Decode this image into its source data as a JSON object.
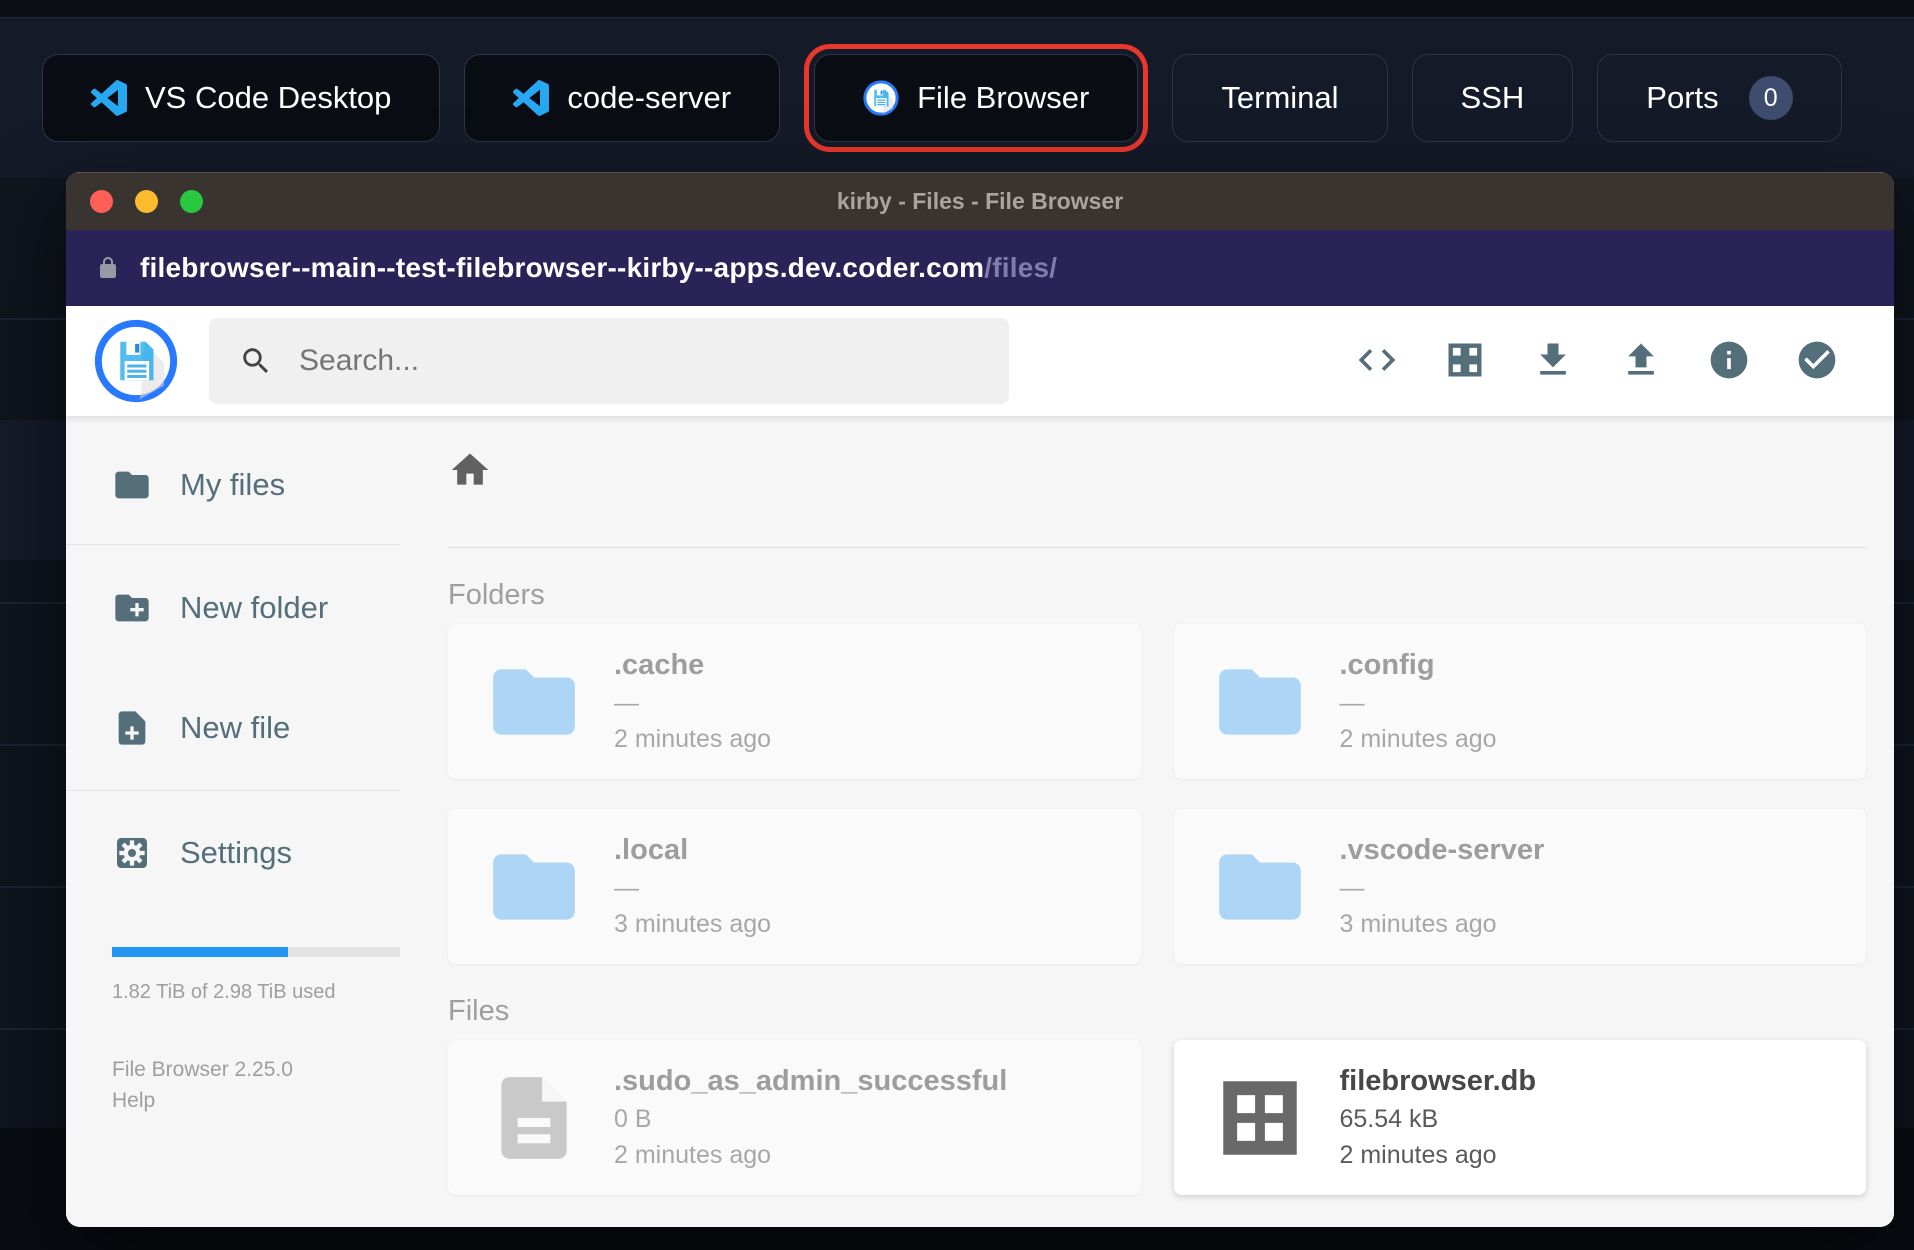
{
  "topbar": {
    "buttons": [
      {
        "label": "VS Code Desktop",
        "icon": "vscode",
        "style": "dark",
        "highlighted": false
      },
      {
        "label": "code-server",
        "icon": "vscode",
        "style": "dark",
        "highlighted": false
      },
      {
        "label": "File Browser",
        "icon": "filebrowser",
        "style": "dark",
        "highlighted": true
      },
      {
        "label": "Terminal",
        "style": "outline",
        "highlighted": false
      },
      {
        "label": "SSH",
        "style": "outline",
        "highlighted": false
      },
      {
        "label": "Ports",
        "style": "outline",
        "badge": "0",
        "highlighted": false
      }
    ]
  },
  "win": {
    "title": "kirby - Files - File Browser",
    "url": {
      "host": "filebrowser--main--test-filebrowser--kirby--apps.dev.coder.com",
      "path": "/files/"
    },
    "toolbar": {
      "search_placeholder": "Search...",
      "icons": [
        "code",
        "grid-view",
        "download",
        "upload",
        "info",
        "check-circle"
      ]
    },
    "sidebar": {
      "items": [
        {
          "label": "My files",
          "icon": "folder"
        },
        {
          "label": "New folder",
          "icon": "new-folder"
        },
        {
          "label": "New file",
          "icon": "new-file"
        },
        {
          "label": "Settings",
          "icon": "settings"
        }
      ],
      "storage": {
        "used_percent": 61,
        "label": "1.82 TiB of 2.98 TiB used"
      },
      "version": "File Browser 2.25.0",
      "help_label": "Help"
    },
    "content": {
      "sections": [
        {
          "title": "Folders",
          "items": [
            {
              "name": ".cache",
              "size": "—",
              "modified": "2 minutes ago",
              "icon": "folder",
              "faded": true
            },
            {
              "name": ".config",
              "size": "—",
              "modified": "2 minutes ago",
              "icon": "folder",
              "faded": true
            },
            {
              "name": ".local",
              "size": "—",
              "modified": "3 minutes ago",
              "icon": "folder",
              "faded": true
            },
            {
              "name": ".vscode-server",
              "size": "—",
              "modified": "3 minutes ago",
              "icon": "folder",
              "faded": true
            }
          ]
        },
        {
          "title": "Files",
          "items": [
            {
              "name": ".sudo_as_admin_successful",
              "size": "0 B",
              "modified": "2 minutes ago",
              "icon": "doc",
              "faded": true
            },
            {
              "name": "filebrowser.db",
              "size": "65.54 kB",
              "modified": "2 minutes ago",
              "icon": "db",
              "faded": false
            }
          ]
        }
      ]
    }
  },
  "colors": {
    "accent_blue": "#2196f3",
    "highlight_ring_red": "#e8372b",
    "toolbar_icon_slate": "#546e7a",
    "urlbar_purple": "#2a2357",
    "titlebar_brown": "#3a3431",
    "folder_icon_blue": "#64b5f6"
  }
}
